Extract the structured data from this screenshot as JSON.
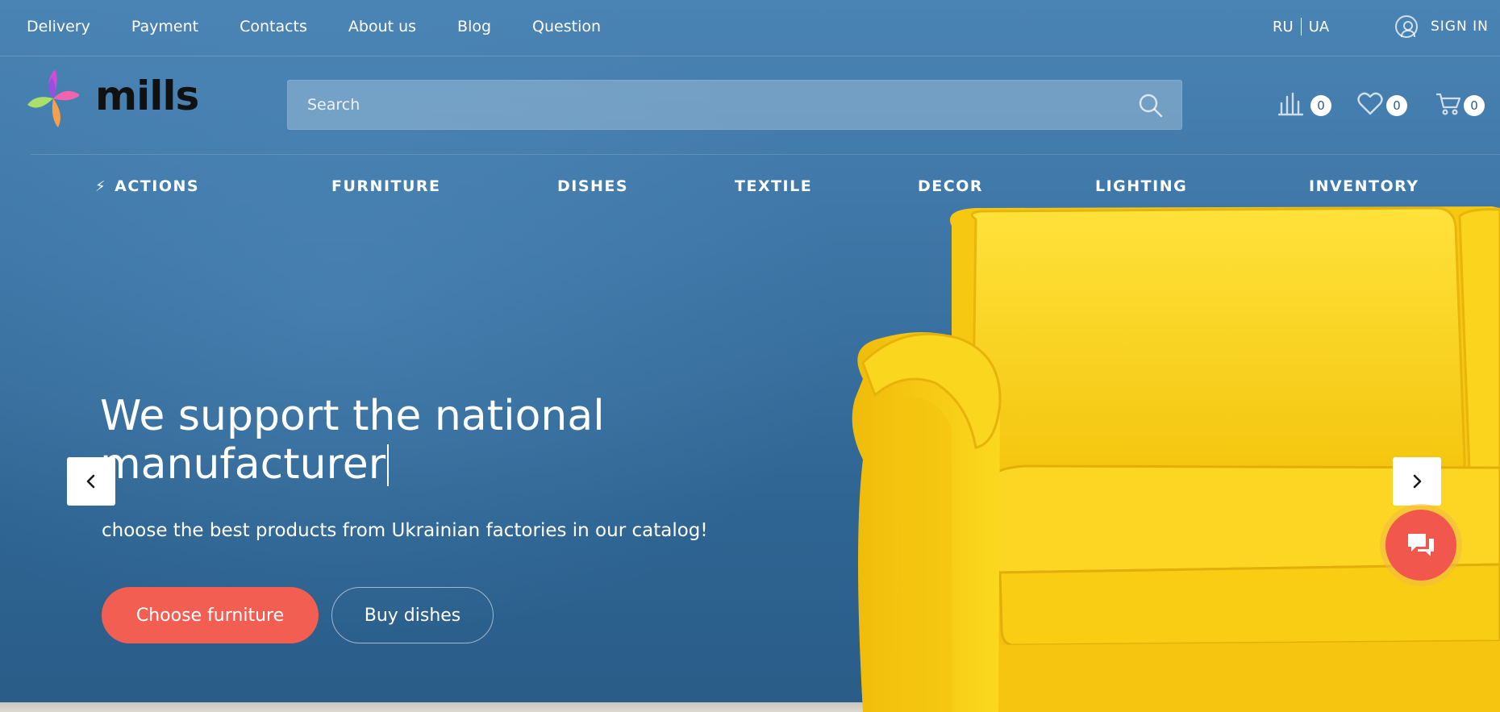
{
  "topbar": {
    "links": [
      "Delivery",
      "Payment",
      "Contacts",
      "About us",
      "Blog",
      "Question"
    ],
    "lang": {
      "ru": "RU",
      "ua": "UA"
    },
    "signin": "SIGN IN"
  },
  "header": {
    "logo_text": "mills",
    "search_placeholder": "Search",
    "compare_count": "0",
    "wishlist_count": "0",
    "cart_count": "0"
  },
  "nav": {
    "items": [
      "ACTIONS",
      "FURNITURE",
      "DISHES",
      "TEXTILE",
      "DECOR",
      "LIGHTING",
      "INVENTORY"
    ]
  },
  "hero": {
    "title": "We support the national manufacturer",
    "subtitle": "choose the best products from Ukrainian factories in our catalog!",
    "primary_button": "Choose furniture",
    "secondary_button": "Buy dishes"
  },
  "colors": {
    "accent": "#f25e52",
    "background": "#3f78a8",
    "sofa": "#f9d21f"
  }
}
